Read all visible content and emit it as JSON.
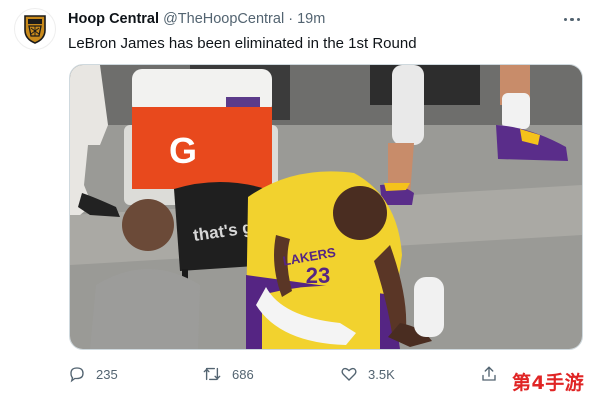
{
  "tweet": {
    "author_name": "Hoop Central",
    "handle": "@TheHoopCentral",
    "separator": "·",
    "time": "19m",
    "text": "LeBron James has been eliminated in the 1st Round"
  },
  "media": {
    "cooler_brand": "G",
    "chair_text": "that's g",
    "jersey_text": "LAKERS",
    "jersey_number": "23",
    "colors": {
      "floor": "#9a9a96",
      "cooler_red": "#e8491d",
      "jersey_gold": "#f2d22e",
      "jersey_purple": "#552583"
    }
  },
  "actions": {
    "reply_count": "235",
    "retweet_count": "686",
    "like_count": "3.5K"
  },
  "watermark": "第4手游",
  "icons": {
    "avatar": "hoop-central-logo",
    "more": "more-dots-icon",
    "reply": "reply-icon",
    "retweet": "retweet-icon",
    "like": "heart-icon",
    "share": "share-icon"
  }
}
